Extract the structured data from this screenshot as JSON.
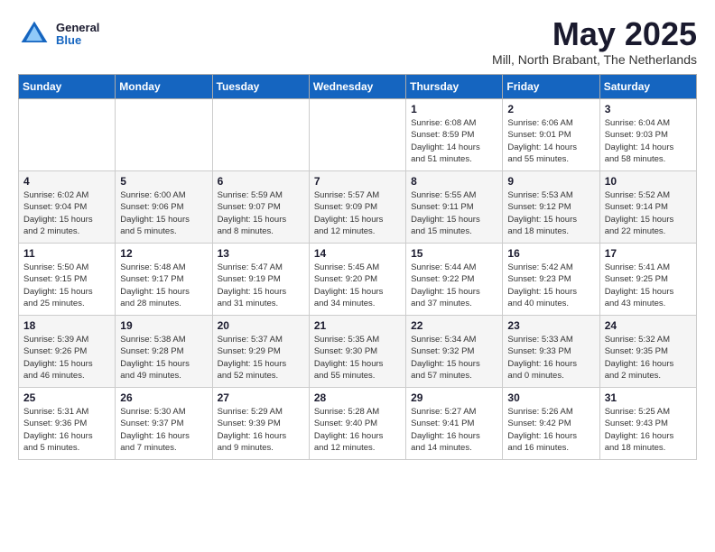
{
  "header": {
    "logo_general": "General",
    "logo_blue": "Blue",
    "month_title": "May 2025",
    "location": "Mill, North Brabant, The Netherlands"
  },
  "weekdays": [
    "Sunday",
    "Monday",
    "Tuesday",
    "Wednesday",
    "Thursday",
    "Friday",
    "Saturday"
  ],
  "weeks": [
    [
      {
        "day": "",
        "info": ""
      },
      {
        "day": "",
        "info": ""
      },
      {
        "day": "",
        "info": ""
      },
      {
        "day": "",
        "info": ""
      },
      {
        "day": "1",
        "info": "Sunrise: 6:08 AM\nSunset: 8:59 PM\nDaylight: 14 hours\nand 51 minutes."
      },
      {
        "day": "2",
        "info": "Sunrise: 6:06 AM\nSunset: 9:01 PM\nDaylight: 14 hours\nand 55 minutes."
      },
      {
        "day": "3",
        "info": "Sunrise: 6:04 AM\nSunset: 9:03 PM\nDaylight: 14 hours\nand 58 minutes."
      }
    ],
    [
      {
        "day": "4",
        "info": "Sunrise: 6:02 AM\nSunset: 9:04 PM\nDaylight: 15 hours\nand 2 minutes."
      },
      {
        "day": "5",
        "info": "Sunrise: 6:00 AM\nSunset: 9:06 PM\nDaylight: 15 hours\nand 5 minutes."
      },
      {
        "day": "6",
        "info": "Sunrise: 5:59 AM\nSunset: 9:07 PM\nDaylight: 15 hours\nand 8 minutes."
      },
      {
        "day": "7",
        "info": "Sunrise: 5:57 AM\nSunset: 9:09 PM\nDaylight: 15 hours\nand 12 minutes."
      },
      {
        "day": "8",
        "info": "Sunrise: 5:55 AM\nSunset: 9:11 PM\nDaylight: 15 hours\nand 15 minutes."
      },
      {
        "day": "9",
        "info": "Sunrise: 5:53 AM\nSunset: 9:12 PM\nDaylight: 15 hours\nand 18 minutes."
      },
      {
        "day": "10",
        "info": "Sunrise: 5:52 AM\nSunset: 9:14 PM\nDaylight: 15 hours\nand 22 minutes."
      }
    ],
    [
      {
        "day": "11",
        "info": "Sunrise: 5:50 AM\nSunset: 9:15 PM\nDaylight: 15 hours\nand 25 minutes."
      },
      {
        "day": "12",
        "info": "Sunrise: 5:48 AM\nSunset: 9:17 PM\nDaylight: 15 hours\nand 28 minutes."
      },
      {
        "day": "13",
        "info": "Sunrise: 5:47 AM\nSunset: 9:19 PM\nDaylight: 15 hours\nand 31 minutes."
      },
      {
        "day": "14",
        "info": "Sunrise: 5:45 AM\nSunset: 9:20 PM\nDaylight: 15 hours\nand 34 minutes."
      },
      {
        "day": "15",
        "info": "Sunrise: 5:44 AM\nSunset: 9:22 PM\nDaylight: 15 hours\nand 37 minutes."
      },
      {
        "day": "16",
        "info": "Sunrise: 5:42 AM\nSunset: 9:23 PM\nDaylight: 15 hours\nand 40 minutes."
      },
      {
        "day": "17",
        "info": "Sunrise: 5:41 AM\nSunset: 9:25 PM\nDaylight: 15 hours\nand 43 minutes."
      }
    ],
    [
      {
        "day": "18",
        "info": "Sunrise: 5:39 AM\nSunset: 9:26 PM\nDaylight: 15 hours\nand 46 minutes."
      },
      {
        "day": "19",
        "info": "Sunrise: 5:38 AM\nSunset: 9:28 PM\nDaylight: 15 hours\nand 49 minutes."
      },
      {
        "day": "20",
        "info": "Sunrise: 5:37 AM\nSunset: 9:29 PM\nDaylight: 15 hours\nand 52 minutes."
      },
      {
        "day": "21",
        "info": "Sunrise: 5:35 AM\nSunset: 9:30 PM\nDaylight: 15 hours\nand 55 minutes."
      },
      {
        "day": "22",
        "info": "Sunrise: 5:34 AM\nSunset: 9:32 PM\nDaylight: 15 hours\nand 57 minutes."
      },
      {
        "day": "23",
        "info": "Sunrise: 5:33 AM\nSunset: 9:33 PM\nDaylight: 16 hours\nand 0 minutes."
      },
      {
        "day": "24",
        "info": "Sunrise: 5:32 AM\nSunset: 9:35 PM\nDaylight: 16 hours\nand 2 minutes."
      }
    ],
    [
      {
        "day": "25",
        "info": "Sunrise: 5:31 AM\nSunset: 9:36 PM\nDaylight: 16 hours\nand 5 minutes."
      },
      {
        "day": "26",
        "info": "Sunrise: 5:30 AM\nSunset: 9:37 PM\nDaylight: 16 hours\nand 7 minutes."
      },
      {
        "day": "27",
        "info": "Sunrise: 5:29 AM\nSunset: 9:39 PM\nDaylight: 16 hours\nand 9 minutes."
      },
      {
        "day": "28",
        "info": "Sunrise: 5:28 AM\nSunset: 9:40 PM\nDaylight: 16 hours\nand 12 minutes."
      },
      {
        "day": "29",
        "info": "Sunrise: 5:27 AM\nSunset: 9:41 PM\nDaylight: 16 hours\nand 14 minutes."
      },
      {
        "day": "30",
        "info": "Sunrise: 5:26 AM\nSunset: 9:42 PM\nDaylight: 16 hours\nand 16 minutes."
      },
      {
        "day": "31",
        "info": "Sunrise: 5:25 AM\nSunset: 9:43 PM\nDaylight: 16 hours\nand 18 minutes."
      }
    ]
  ]
}
